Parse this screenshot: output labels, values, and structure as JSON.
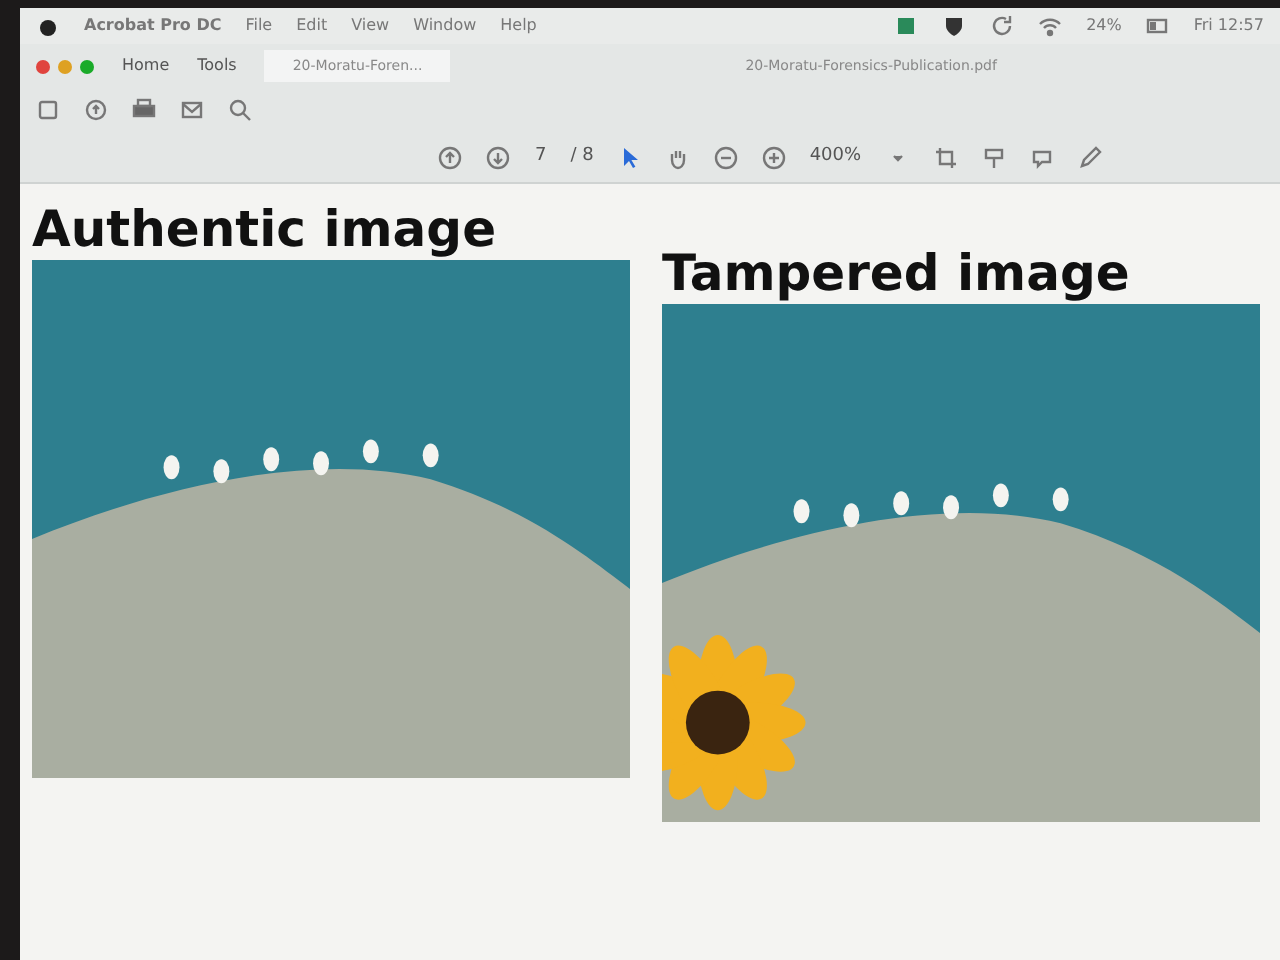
{
  "menu_bar": {
    "app": "Acrobat Pro DC",
    "items": [
      "File",
      "Edit",
      "View",
      "Window",
      "Help"
    ],
    "battery": "24%",
    "clock": "Fri 12:57"
  },
  "tabs": [
    {
      "label": "Home",
      "selected": false
    },
    {
      "label": "Tools",
      "selected": false
    },
    {
      "label": "20-Moratu-Foren...",
      "selected": true
    }
  ],
  "document_title": "20-Moratu-Forensics-Publication.pdf",
  "toolbar": {
    "page": "7",
    "page_total": "/ 8",
    "zoom": "400%"
  },
  "figures": [
    {
      "caption": "Authentic image",
      "kind": "authentic"
    },
    {
      "caption": "Tampered image",
      "kind": "tampered"
    }
  ]
}
